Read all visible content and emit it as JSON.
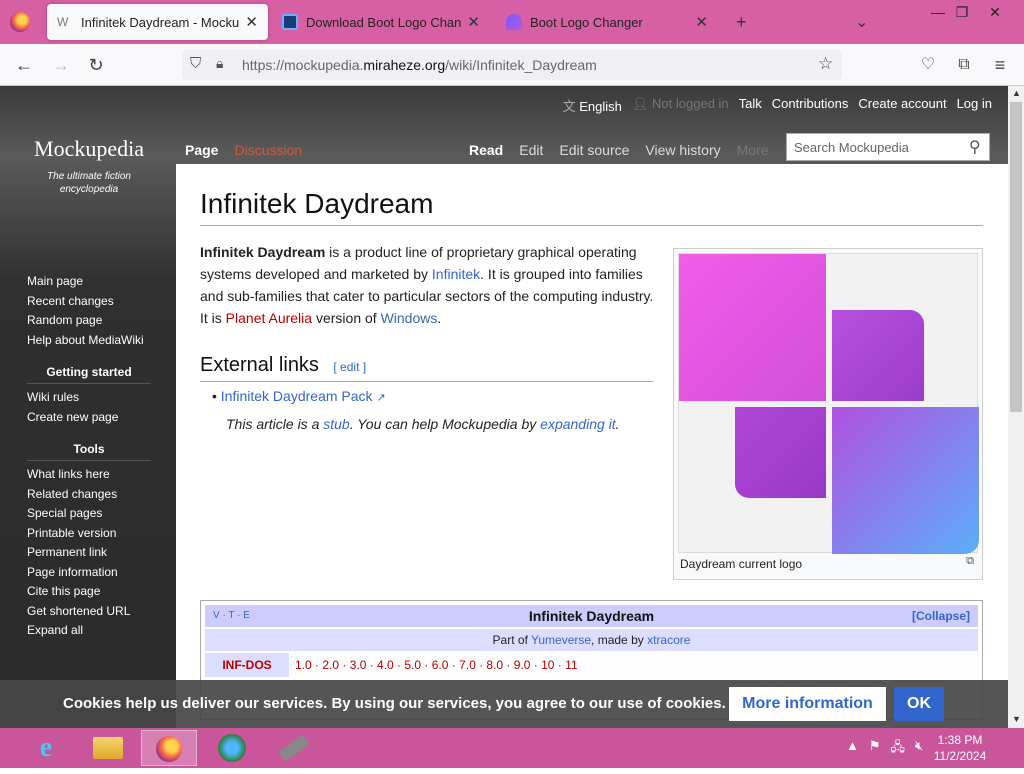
{
  "browser": {
    "tabs": [
      {
        "label": "Infinitek Daydream - Mockupedia",
        "active": true
      },
      {
        "label": "Download Boot Logo Changer",
        "active": false
      },
      {
        "label": "Boot Logo Changer",
        "active": false
      }
    ],
    "new_tab": "+",
    "tab_list": "⌄",
    "window": {
      "minimize": "—",
      "maximize": "❐",
      "close": "✕"
    },
    "url_prefix": "https://mockupedia.",
    "url_domain": "miraheze.org",
    "url_path": "/wiki/Infinitek_Daydream"
  },
  "wiki": {
    "user_menu": {
      "language": "English",
      "not_logged_in": "Not logged in",
      "talk": "Talk",
      "contributions": "Contributions",
      "create_account": "Create account",
      "login": "Log in"
    },
    "logo": {
      "name": "Mockupedia",
      "tagline_1": "The ultimate fiction",
      "tagline_2": "encyclopedia"
    },
    "page_tabs": {
      "page": "Page",
      "discussion": "Discussion"
    },
    "view_tabs": {
      "read": "Read",
      "edit": "Edit",
      "edit_source": "Edit source",
      "history": "View history",
      "more": "More"
    },
    "search_placeholder": "Search Mockupedia",
    "sidebar": {
      "nav": [
        "Main page",
        "Recent changes",
        "Random page",
        "Help about MediaWiki"
      ],
      "getting_started_title": "Getting started",
      "getting_started": [
        "Wiki rules",
        "Create new page"
      ],
      "tools_title": "Tools",
      "tools": [
        "What links here",
        "Related changes",
        "Special pages",
        "Printable version",
        "Permanent link",
        "Page information",
        "Cite this page",
        "Get shortened URL",
        "Expand all"
      ]
    },
    "title": "Infinitek Daydream",
    "intro": {
      "bold": "Infinitek Daydream",
      "t1": " is a product line of proprietary graphical operating systems developed and marketed by ",
      "link_infinitek": "Infinitek",
      "t2": ". It is grouped into families and sub-families that cater to particular sectors of the computing industry. It is ",
      "link_aurelia": "Planet Aurelia",
      "t3": " version of ",
      "link_windows": "Windows",
      "t4": "."
    },
    "external_links": {
      "heading": "External links",
      "edit": "[ edit ]",
      "item": "Infinitek Daydream Pack"
    },
    "stub": {
      "t1": "This article is a ",
      "link_stub": "stub",
      "t2": ". You can help Mockupedia by ",
      "link_expand": "expanding it",
      "t3": "."
    },
    "infobox_caption": "Daydream current logo",
    "navbox": {
      "vte": "V · T · E",
      "title": "Infinitek Daydream",
      "collapse": "[Collapse]",
      "sub_1": "Part of ",
      "sub_link1": "Yumeverse",
      "sub_2": ", made by ",
      "sub_link2": "xtracore",
      "row_label": "INF-DOS",
      "row_values": "1.0 · 2.0 · 3.0 · 4.0 · 5.0 · 6.0 · 7.0 · 8.0 · 9.0 · 10 · 11"
    }
  },
  "cookie": {
    "text": "Cookies help us deliver our services. By using our services, you agree to our use of cookies.",
    "more": "More information",
    "ok": "OK"
  },
  "taskbar": {
    "time": "1:38 PM",
    "date": "11/2/2024"
  },
  "colors": {
    "accent": "#d75fa3",
    "taskbar": "#c9569a",
    "link": "#3366cc",
    "redlink": "#ba0000"
  }
}
